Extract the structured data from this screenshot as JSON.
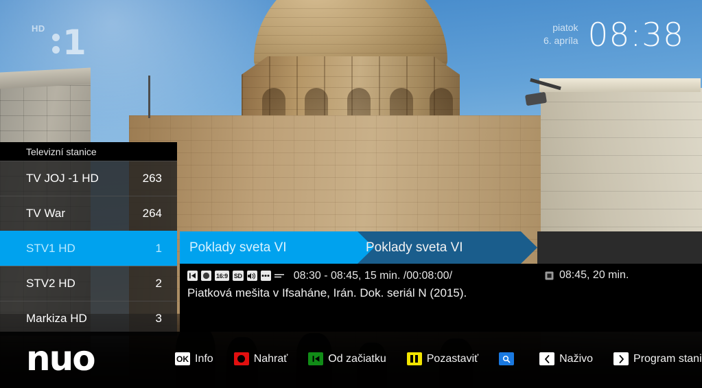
{
  "station_logo": {
    "hd_label": "HD",
    "channel_mark": "1",
    "icon": "stv1-hd-logo"
  },
  "clock": {
    "weekday": "piatok",
    "date": "6. apríla",
    "time": "08:38"
  },
  "channel_list": {
    "header": "Televizní stanice",
    "items": [
      {
        "name": "TV JOJ -1 HD",
        "number": "263",
        "selected": false
      },
      {
        "name": "TV War",
        "number": "264",
        "selected": false
      },
      {
        "name": "STV1 HD",
        "number": "1",
        "selected": true
      },
      {
        "name": "STV2 HD",
        "number": "2",
        "selected": false
      },
      {
        "name": "Markiza HD",
        "number": "3",
        "selected": false
      }
    ]
  },
  "now_playing": {
    "title": "Poklady sveta VI",
    "times": "08:30 - 08:45, 15 min.  /00:08:00/",
    "description": "Piatková mešita v Ifsaháne, Irán. Dok. seriál N (2015).",
    "badges": [
      {
        "name": "skip-to-start-icon",
        "type": "glyph",
        "glyph": "skip-back"
      },
      {
        "name": "record-icon",
        "type": "glyph",
        "glyph": "circle"
      },
      {
        "name": "aspect-ratio-badge",
        "type": "text",
        "text": "16:9"
      },
      {
        "name": "sd-quality-badge",
        "type": "text",
        "text": "SD"
      },
      {
        "name": "audio-track-icon",
        "type": "glyph",
        "glyph": "audio"
      },
      {
        "name": "subtitles-icon",
        "type": "glyph",
        "glyph": "dots"
      },
      {
        "name": "teletext-icon",
        "type": "glyph",
        "glyph": "lines"
      }
    ]
  },
  "next_program": {
    "title": "Poklady sveta VI",
    "times": "08:45, 20 min.",
    "icon": "stop-square-icon"
  },
  "actions": [
    {
      "key_label": "OK",
      "key_style": "white",
      "icon": "ok-key",
      "label": "Info"
    },
    {
      "key_label": "",
      "key_style": "red",
      "icon": "record-key",
      "label": "Nahrať"
    },
    {
      "key_label": "",
      "key_style": "green",
      "icon": "skip-back-key",
      "label": "Od začiatku"
    },
    {
      "key_label": "",
      "key_style": "yellow",
      "icon": "pause-key",
      "label": "Pozastaviť"
    },
    {
      "key_label": "",
      "key_style": "blue",
      "icon": "search-key",
      "label": ""
    },
    {
      "key_label": "",
      "key_style": "plain",
      "icon": "chevron-left-key",
      "label": "Naživo"
    },
    {
      "key_label": "",
      "key_style": "plain",
      "icon": "chevron-right-key",
      "label": "Program stanice"
    }
  ],
  "provider_logo": "nuo",
  "colors": {
    "accent_blue": "#00a2ee",
    "track_blue": "#1a5d8c",
    "panel_gray": "#2b2b2b",
    "red": "#e10f0f",
    "green": "#118c17",
    "yellow": "#f2e500",
    "blue": "#1a79e0"
  }
}
